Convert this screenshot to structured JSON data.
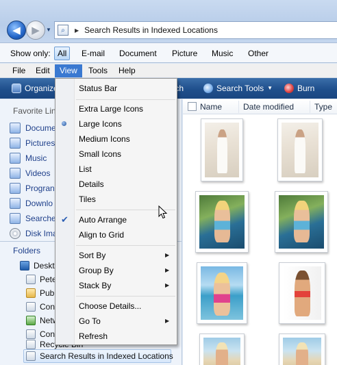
{
  "address": {
    "path_text": "Search Results in Indexed Locations"
  },
  "show_only": {
    "label": "Show only:",
    "filters": [
      "All",
      "E-mail",
      "Document",
      "Picture",
      "Music",
      "Other"
    ],
    "active": "All"
  },
  "menubar": {
    "items": [
      "File",
      "Edit",
      "View",
      "Tools",
      "Help"
    ],
    "open": "View"
  },
  "toolbar": {
    "organize": "Organize",
    "search": "Search",
    "search_tools": "Search Tools",
    "burn": "Burn"
  },
  "nav": {
    "favorites_heading": "Favorite Lin",
    "favorites": [
      "Docume",
      "Pictures",
      "Music",
      "Videos",
      "Progran",
      "Downlo",
      "Searche",
      "Disk Ima"
    ],
    "folders_heading": "Folders",
    "tree": [
      "Deskto",
      "Pete",
      "Pub",
      "Con",
      "Netw",
      "Con",
      "Recycle Bin",
      "Search Results in Indexed Locations"
    ]
  },
  "columns": {
    "name": "Name",
    "date_modified": "Date modified",
    "type": "Type"
  },
  "view_menu": {
    "status_bar": "Status Bar",
    "extra_large_icons": "Extra Large Icons",
    "large_icons": "Large Icons",
    "medium_icons": "Medium Icons",
    "small_icons": "Small Icons",
    "list": "List",
    "details": "Details",
    "tiles": "Tiles",
    "auto_arrange": "Auto Arrange",
    "align_to_grid": "Align to Grid",
    "sort_by": "Sort By",
    "group_by": "Group By",
    "stack_by": "Stack By",
    "choose_details": "Choose Details...",
    "go_to": "Go To",
    "refresh": "Refresh",
    "selected_view": "Large Icons",
    "auto_arrange_checked": true
  },
  "colors": {
    "toolbar": "#1f4f8c",
    "menu_highlight": "#3a79d1",
    "link_text": "#1e3f8a"
  }
}
